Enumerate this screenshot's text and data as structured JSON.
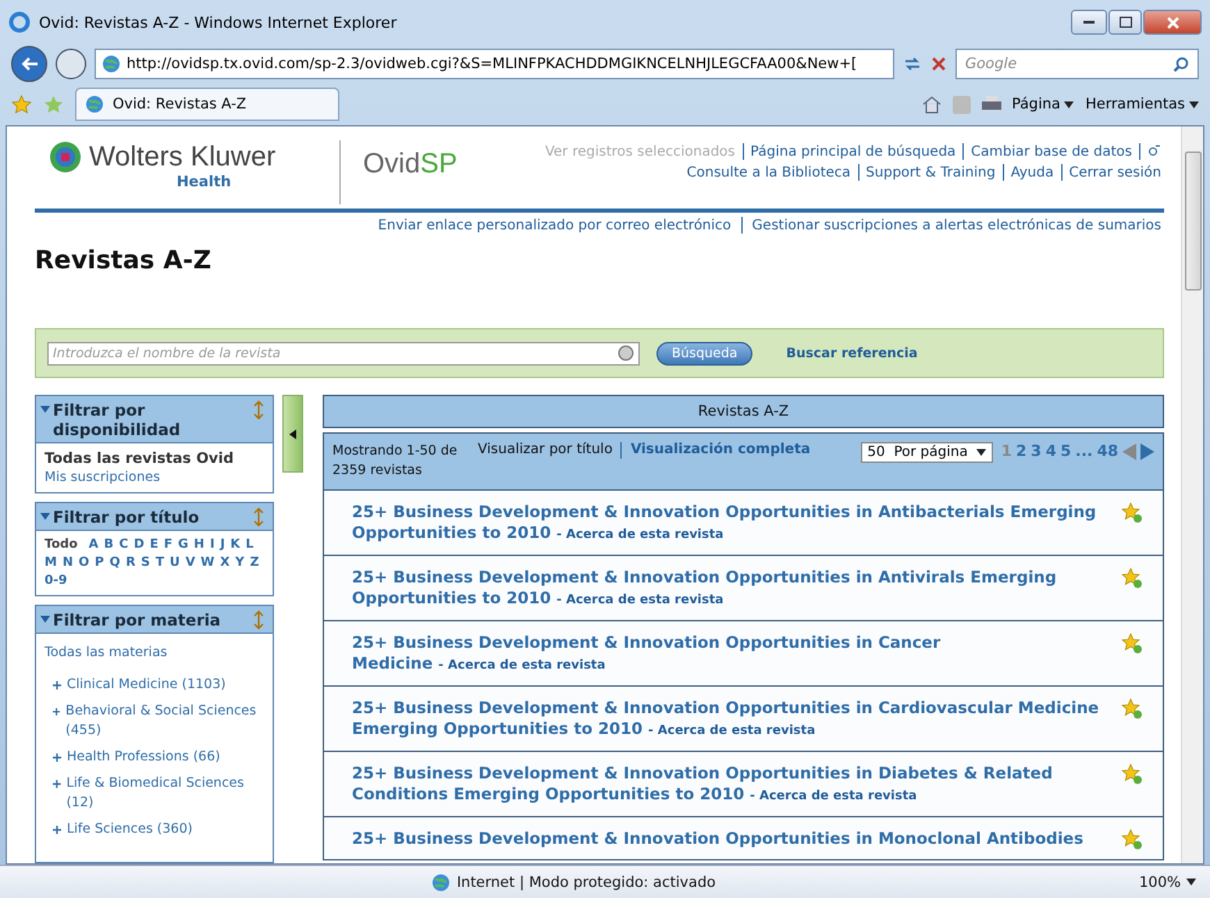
{
  "window": {
    "title": "Ovid: Revistas A-Z - Windows Internet Explorer"
  },
  "address_bar": {
    "url": "http://ovidsp.tx.ovid.com/sp-2.3/ovidweb.cgi?&S=MLINFPKACHDDMGIKNCELNHJLEGCFAA00&New+[",
    "search_placeholder": "Google"
  },
  "tab": {
    "label": "Ovid: Revistas A-Z"
  },
  "command_bar": [
    "Página",
    "Herramientas"
  ],
  "header": {
    "brand": "Wolters Kluwer",
    "brand_sub": "Health",
    "product_a": "Ovid",
    "product_b": "SP",
    "links_row1": [
      {
        "label": "Ver registros seleccionados",
        "disabled": true
      },
      {
        "label": "Página principal de búsqueda",
        "disabled": false
      },
      {
        "label": "Cambiar base de datos",
        "disabled": false
      }
    ],
    "links_row2": [
      "Consulte a la Biblioteca",
      "Support & Training",
      "Ayuda",
      "Cerrar sesión"
    ],
    "links_row3": [
      "Enviar enlace personalizado por correo electrónico",
      "Gestionar suscripciones a alertas electrónicas de sumarios"
    ]
  },
  "page_title": "Revistas A-Z",
  "search": {
    "placeholder": "Introduzca el nombre de la revista",
    "button": "Búsqueda",
    "link": "Buscar referencia"
  },
  "sidebar": [
    {
      "kind": "options",
      "title": "Filtrar por disponibilidad",
      "items": [
        {
          "label": "Todas las revistas Ovid",
          "selected": true
        },
        {
          "label": "Mis suscripciones",
          "selected": false
        }
      ]
    },
    {
      "kind": "letters",
      "title": "Filtrar por título",
      "items": [
        {
          "label": "Todo",
          "selected": true
        },
        {
          "label": "A",
          "selected": false
        },
        {
          "label": "B",
          "selected": false
        },
        {
          "label": "C",
          "selected": false
        },
        {
          "label": "D",
          "selected": false
        },
        {
          "label": "E",
          "selected": false
        },
        {
          "label": "F",
          "selected": false
        },
        {
          "label": "G",
          "selected": false
        },
        {
          "label": "H",
          "selected": false
        },
        {
          "label": "I",
          "selected": false
        },
        {
          "label": "J",
          "selected": false
        },
        {
          "label": "K",
          "selected": false
        },
        {
          "label": "L",
          "selected": false
        },
        {
          "label": "M",
          "selected": false
        },
        {
          "label": "N",
          "selected": false
        },
        {
          "label": "O",
          "selected": false
        },
        {
          "label": "P",
          "selected": false
        },
        {
          "label": "Q",
          "selected": false
        },
        {
          "label": "R",
          "selected": false
        },
        {
          "label": "S",
          "selected": false
        },
        {
          "label": "T",
          "selected": false
        },
        {
          "label": "U",
          "selected": false
        },
        {
          "label": "V",
          "selected": false
        },
        {
          "label": "W",
          "selected": false
        },
        {
          "label": "X",
          "selected": false
        },
        {
          "label": "Y",
          "selected": false
        },
        {
          "label": "Z",
          "selected": false
        },
        {
          "label": "0-9",
          "selected": false
        }
      ]
    },
    {
      "kind": "subjects",
      "title": "Filtrar por materia",
      "all": "Todas las materias",
      "items": [
        {
          "label": "Clinical Medicine (1103)",
          "expanded": false
        },
        {
          "label": "Behavioral & Social Sciences (455)",
          "expanded": false
        },
        {
          "label": "Health Professions (66)",
          "expanded": false
        },
        {
          "label": "Life & Biomedical Sciences (12)",
          "expanded": false
        },
        {
          "label": "Life Sciences (360)",
          "expanded": false
        }
      ]
    }
  ],
  "results": {
    "title": "Revistas A-Z",
    "showing": "Mostrando 1-50 de 2359 revistas",
    "view_label": "Visualizar por título",
    "view_link": "Visualización completa",
    "per_page": "50  Por página",
    "pages": [
      {
        "label": "1",
        "selected": true
      },
      {
        "label": "2",
        "selected": false
      },
      {
        "label": "3",
        "selected": false
      },
      {
        "label": "4",
        "selected": false
      },
      {
        "label": "5",
        "selected": false
      },
      {
        "label": "...",
        "selected": false
      },
      {
        "label": "48",
        "selected": false
      }
    ],
    "prev_disabled": true,
    "rows": [
      {
        "title": "25+ Business Development & Innovation Opportunities in Antibacterials Emerging Opportunities to 2010",
        "about": "- Acerca de esta revista"
      },
      {
        "title": "25+ Business Development & Innovation Opportunities in Antivirals Emerging Opportunities to 2010",
        "about": "- Acerca de esta revista"
      },
      {
        "title": "25+ Business Development & Innovation Opportunities in Cancer Medicine",
        "about": "- Acerca de esta revista"
      },
      {
        "title": "25+ Business Development & Innovation Opportunities in Cardiovascular Medicine Emerging Opportunities to 2010",
        "about": "- Acerca de esta revista"
      },
      {
        "title": "25+ Business Development & Innovation Opportunities in Diabetes & Related Conditions Emerging Opportunities to 2010",
        "about": "- Acerca de esta revista"
      },
      {
        "title": "25+ Business Development & Innovation Opportunities in Monoclonal Antibodies",
        "about": ""
      }
    ]
  },
  "status_bar": {
    "zone": "Internet | Modo protegido: activado",
    "zoom": "100%"
  }
}
